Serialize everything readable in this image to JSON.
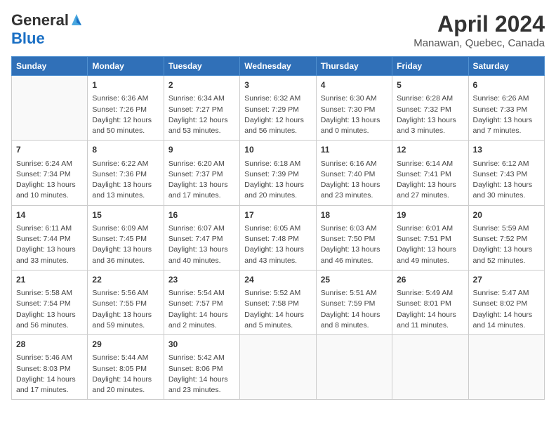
{
  "header": {
    "logo_general": "General",
    "logo_blue": "Blue",
    "title": "April 2024",
    "subtitle": "Manawan, Quebec, Canada"
  },
  "weekdays": [
    "Sunday",
    "Monday",
    "Tuesday",
    "Wednesday",
    "Thursday",
    "Friday",
    "Saturday"
  ],
  "weeks": [
    [
      {
        "day": "",
        "content": ""
      },
      {
        "day": "1",
        "content": "Sunrise: 6:36 AM\nSunset: 7:26 PM\nDaylight: 12 hours\nand 50 minutes."
      },
      {
        "day": "2",
        "content": "Sunrise: 6:34 AM\nSunset: 7:27 PM\nDaylight: 12 hours\nand 53 minutes."
      },
      {
        "day": "3",
        "content": "Sunrise: 6:32 AM\nSunset: 7:29 PM\nDaylight: 12 hours\nand 56 minutes."
      },
      {
        "day": "4",
        "content": "Sunrise: 6:30 AM\nSunset: 7:30 PM\nDaylight: 13 hours\nand 0 minutes."
      },
      {
        "day": "5",
        "content": "Sunrise: 6:28 AM\nSunset: 7:32 PM\nDaylight: 13 hours\nand 3 minutes."
      },
      {
        "day": "6",
        "content": "Sunrise: 6:26 AM\nSunset: 7:33 PM\nDaylight: 13 hours\nand 7 minutes."
      }
    ],
    [
      {
        "day": "7",
        "content": "Sunrise: 6:24 AM\nSunset: 7:34 PM\nDaylight: 13 hours\nand 10 minutes."
      },
      {
        "day": "8",
        "content": "Sunrise: 6:22 AM\nSunset: 7:36 PM\nDaylight: 13 hours\nand 13 minutes."
      },
      {
        "day": "9",
        "content": "Sunrise: 6:20 AM\nSunset: 7:37 PM\nDaylight: 13 hours\nand 17 minutes."
      },
      {
        "day": "10",
        "content": "Sunrise: 6:18 AM\nSunset: 7:39 PM\nDaylight: 13 hours\nand 20 minutes."
      },
      {
        "day": "11",
        "content": "Sunrise: 6:16 AM\nSunset: 7:40 PM\nDaylight: 13 hours\nand 23 minutes."
      },
      {
        "day": "12",
        "content": "Sunrise: 6:14 AM\nSunset: 7:41 PM\nDaylight: 13 hours\nand 27 minutes."
      },
      {
        "day": "13",
        "content": "Sunrise: 6:12 AM\nSunset: 7:43 PM\nDaylight: 13 hours\nand 30 minutes."
      }
    ],
    [
      {
        "day": "14",
        "content": "Sunrise: 6:11 AM\nSunset: 7:44 PM\nDaylight: 13 hours\nand 33 minutes."
      },
      {
        "day": "15",
        "content": "Sunrise: 6:09 AM\nSunset: 7:45 PM\nDaylight: 13 hours\nand 36 minutes."
      },
      {
        "day": "16",
        "content": "Sunrise: 6:07 AM\nSunset: 7:47 PM\nDaylight: 13 hours\nand 40 minutes."
      },
      {
        "day": "17",
        "content": "Sunrise: 6:05 AM\nSunset: 7:48 PM\nDaylight: 13 hours\nand 43 minutes."
      },
      {
        "day": "18",
        "content": "Sunrise: 6:03 AM\nSunset: 7:50 PM\nDaylight: 13 hours\nand 46 minutes."
      },
      {
        "day": "19",
        "content": "Sunrise: 6:01 AM\nSunset: 7:51 PM\nDaylight: 13 hours\nand 49 minutes."
      },
      {
        "day": "20",
        "content": "Sunrise: 5:59 AM\nSunset: 7:52 PM\nDaylight: 13 hours\nand 52 minutes."
      }
    ],
    [
      {
        "day": "21",
        "content": "Sunrise: 5:58 AM\nSunset: 7:54 PM\nDaylight: 13 hours\nand 56 minutes."
      },
      {
        "day": "22",
        "content": "Sunrise: 5:56 AM\nSunset: 7:55 PM\nDaylight: 13 hours\nand 59 minutes."
      },
      {
        "day": "23",
        "content": "Sunrise: 5:54 AM\nSunset: 7:57 PM\nDaylight: 14 hours\nand 2 minutes."
      },
      {
        "day": "24",
        "content": "Sunrise: 5:52 AM\nSunset: 7:58 PM\nDaylight: 14 hours\nand 5 minutes."
      },
      {
        "day": "25",
        "content": "Sunrise: 5:51 AM\nSunset: 7:59 PM\nDaylight: 14 hours\nand 8 minutes."
      },
      {
        "day": "26",
        "content": "Sunrise: 5:49 AM\nSunset: 8:01 PM\nDaylight: 14 hours\nand 11 minutes."
      },
      {
        "day": "27",
        "content": "Sunrise: 5:47 AM\nSunset: 8:02 PM\nDaylight: 14 hours\nand 14 minutes."
      }
    ],
    [
      {
        "day": "28",
        "content": "Sunrise: 5:46 AM\nSunset: 8:03 PM\nDaylight: 14 hours\nand 17 minutes."
      },
      {
        "day": "29",
        "content": "Sunrise: 5:44 AM\nSunset: 8:05 PM\nDaylight: 14 hours\nand 20 minutes."
      },
      {
        "day": "30",
        "content": "Sunrise: 5:42 AM\nSunset: 8:06 PM\nDaylight: 14 hours\nand 23 minutes."
      },
      {
        "day": "",
        "content": ""
      },
      {
        "day": "",
        "content": ""
      },
      {
        "day": "",
        "content": ""
      },
      {
        "day": "",
        "content": ""
      }
    ]
  ]
}
